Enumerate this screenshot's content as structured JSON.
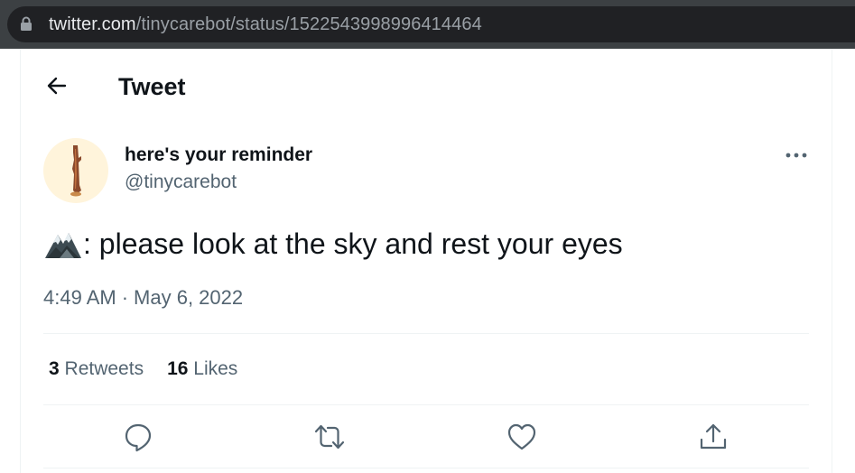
{
  "browser": {
    "url_host": "twitter.com",
    "url_path": "/tinycarebot/status/1522543998996414464",
    "lock_icon": "lock-icon"
  },
  "header": {
    "title": "Tweet",
    "back_icon": "back-arrow-icon"
  },
  "tweet": {
    "author_name": "here's your reminder",
    "author_handle": "@tinycarebot",
    "emoji": "mountain-emoji",
    "text": ": please look at the sky and rest your eyes",
    "time": "4:49 AM",
    "separator": "·",
    "date": "May 6, 2022",
    "more_icon": "more-options-icon"
  },
  "stats": {
    "retweets_count": "3",
    "retweets_label": "Retweets",
    "likes_count": "16",
    "likes_label": "Likes"
  },
  "actions": [
    "reply-icon",
    "retweet-icon",
    "like-icon",
    "share-icon"
  ],
  "colors": {
    "text_primary": "#0f1419",
    "text_secondary": "#536471",
    "divider": "#eff3f4",
    "browser_bar": "#3c4043",
    "avatar_bg": "#fff4db"
  }
}
